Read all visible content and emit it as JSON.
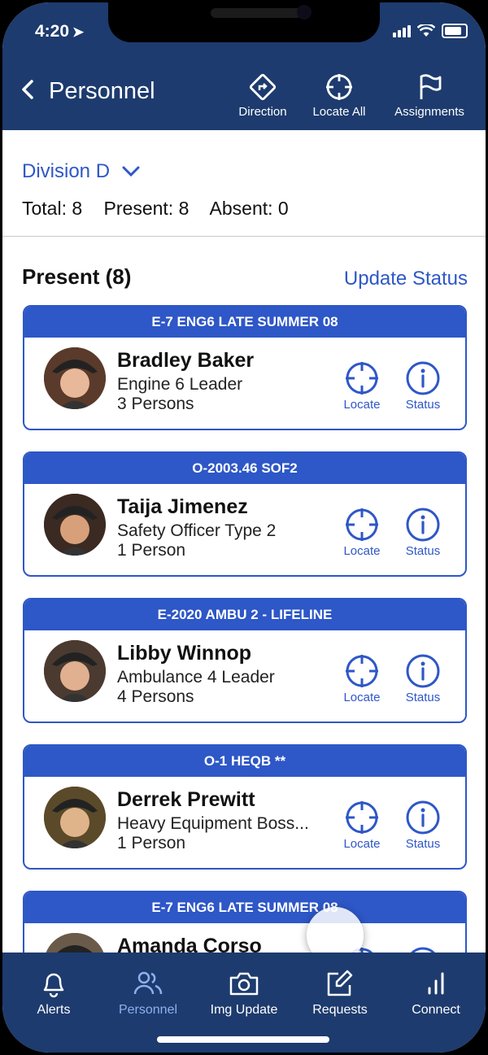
{
  "status_bar": {
    "time": "4:20"
  },
  "header": {
    "back_label": "Personnel",
    "actions": [
      {
        "label": "Direction",
        "icon": "direction-icon"
      },
      {
        "label": "Locate All",
        "icon": "crosshair-icon"
      },
      {
        "label": "Assignments",
        "icon": "flag-icon"
      }
    ]
  },
  "summary": {
    "division": "Division D",
    "total": "Total: 8",
    "present": "Present: 8",
    "absent": "Absent: 0"
  },
  "section": {
    "title": "Present (8)",
    "update_status": "Update Status"
  },
  "cards": [
    {
      "unit": "E-7 ENG6 LATE SUMMER 08",
      "name": "Bradley Baker",
      "role": "Engine 6 Leader",
      "count": "3 Persons",
      "locate": "Locate",
      "status": "Status"
    },
    {
      "unit": "O-2003.46 SOF2",
      "name": "Taija Jimenez",
      "role": "Safety Officer Type 2",
      "count": "1 Person",
      "locate": "Locate",
      "status": "Status"
    },
    {
      "unit": "E-2020 AMBU 2 - LIFELINE",
      "name": "Libby Winnop",
      "role": "Ambulance 4 Leader",
      "count": "4 Persons",
      "locate": "Locate",
      "status": "Status"
    },
    {
      "unit": "O-1 HEQB **",
      "name": "Derrek Prewitt",
      "role": "Heavy Equipment Boss...",
      "count": "1 Person",
      "locate": "Locate",
      "status": "Status"
    },
    {
      "unit": "E-7 ENG6 LATE SUMMER 08",
      "name": "Amanda Corso",
      "role": "",
      "count": "",
      "locate": "",
      "status": ""
    }
  ],
  "tabs": [
    {
      "label": "Alerts",
      "icon": "bell-icon",
      "active": false
    },
    {
      "label": "Personnel",
      "icon": "people-icon",
      "active": true
    },
    {
      "label": "Img Update",
      "icon": "camera-icon",
      "active": false
    },
    {
      "label": "Requests",
      "icon": "edit-icon",
      "active": false
    },
    {
      "label": "Connect",
      "icon": "signal-bars-icon",
      "active": false
    }
  ],
  "colors": {
    "header_bg": "#1d3b6e",
    "accent": "#2e57c7",
    "active_tab": "#8fb0f0"
  }
}
